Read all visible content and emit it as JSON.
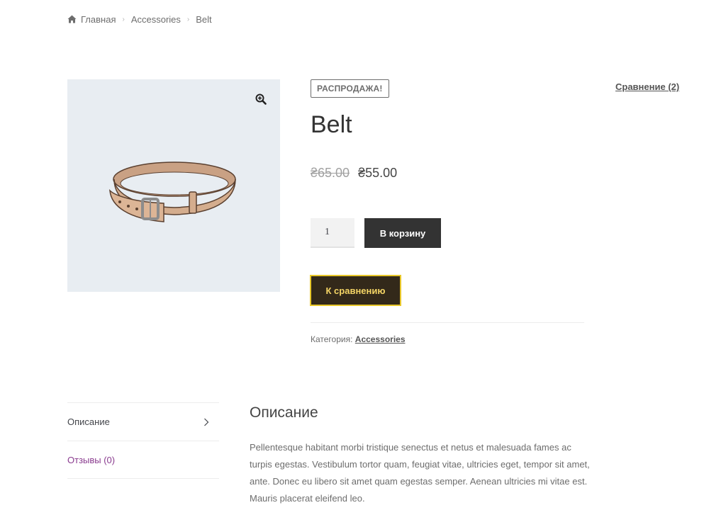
{
  "breadcrumb": {
    "icon": "home-icon",
    "items": [
      "Главная",
      "Accessories",
      "Belt"
    ]
  },
  "product": {
    "sale_badge": "РАСПРОДАЖА!",
    "title": "Belt",
    "old_price": "₴65.00",
    "new_price": "₴55.00",
    "quantity": "1",
    "add_to_cart_label": "В корзину",
    "compare_button_label": "К сравнению",
    "category_label": "Категория:",
    "category_value": "Accessories",
    "image_icon": "belt-illustration",
    "zoom_icon": "zoom-in-icon"
  },
  "compare_link": "Сравнение (2)",
  "tabs": [
    {
      "label": "Описание",
      "icon": "chevron-right-icon"
    },
    {
      "label": "Отзывы (0)"
    }
  ],
  "description": {
    "title": "Описание",
    "text": "Pellentesque habitant morbi tristique senectus et netus et malesuada fames ac turpis egestas. Vestibulum tortor quam, feugiat vitae, ultricies eget, tempor sit amet, ante. Donec eu libero sit amet quam egestas semper. Aenean ultricies mi vitae est. Mauris placerat eleifend leo."
  },
  "colors": {
    "accent_purple": "#8a3c8f",
    "dark_button": "#333333",
    "compare_button_bg": "#33291a",
    "compare_button_border": "#e8c72a",
    "image_bg": "#e8edf2"
  }
}
